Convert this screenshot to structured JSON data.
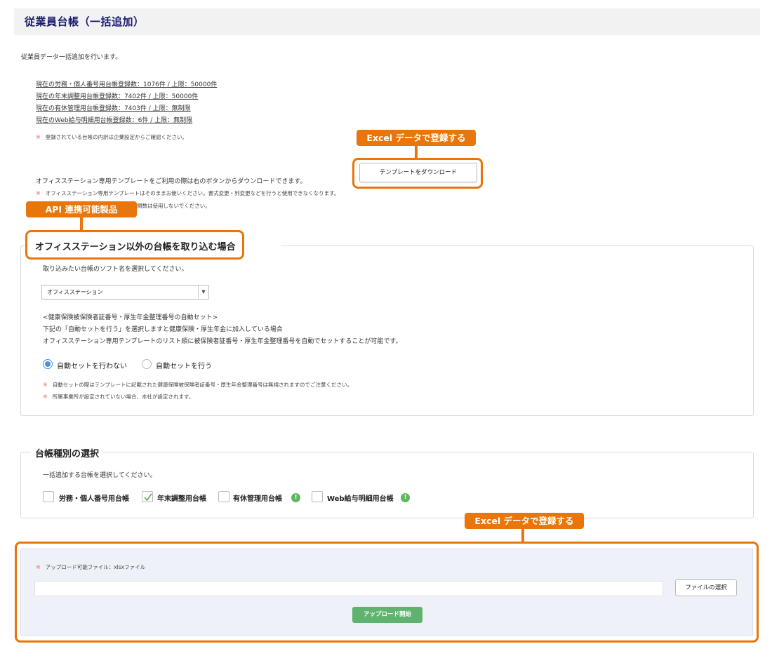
{
  "page": {
    "title": "従業員台帳（一括追加）",
    "intro": "従業員データ一括追加を行います。"
  },
  "counts": [
    "現在の労務・個人番号用台帳登録数：1076件 / 上限：50000件",
    "現在の年末調整用台帳登録数：7402件 / 上限：50000件",
    "現在の有休管理用台帳登録数：7403件 / 上限：無制限",
    "現在のWeb給与明細用台帳登録数：6件 / 上限：無制限"
  ],
  "notes": {
    "mark": "※",
    "ledger_detail": "登録されている台帳の内訳は企業設定からご確認ください。",
    "template_intro": "オフィスステーション専用テンプレートをご利用の際は右のボタンからダウンロードできます。",
    "template_note1": "オフィスステーション専用テンプレートはそのままお使いください。書式変更・列変更などを行うと使用できなくなります。",
    "template_note2_tail": "関数は使用しないでください。"
  },
  "callouts": {
    "excel_top": "Excel データで登録する",
    "api": "API 連携可能製品",
    "excel_bottom": "Excel データで登録する"
  },
  "buttons": {
    "template_download": "テンプレートをダウンロード",
    "file_select": "ファイルの選択",
    "upload_start": "アップロード開始"
  },
  "import_section": {
    "legend": "オフィスステーション以外の台帳を取り込む場合",
    "select_prompt": "取り込みたい台帳のソフト名を選択してください。",
    "select_value": "オフィスステーション",
    "auto_title": "<健康保険被保険者証番号・厚生年金整理番号の自動セット>",
    "auto_line1": "下記の「自動セットを行う」を選択しますと健康保険・厚生年金に加入している場合",
    "auto_line2": "オフィスステーション専用テンプレートのリスト順に被保険者証番号・厚生年金整理番号を自動でセットすることが可能です。",
    "radio_off": "自動セットを行わない",
    "radio_on": "自動セットを行う",
    "selected": "自動セットを行わない",
    "note1": "自動セットの際はテンプレートに記載された健康保険被保険者証番号・厚生年金整理番号は無視されますのでご注意ください。",
    "note2": "所属事業所が設定されていない場合、本社が設定されます。"
  },
  "ledger_section": {
    "legend": "台帳種別の選択",
    "prompt": "一括追加する台帳を選択してください。",
    "options": [
      {
        "label": "労務・個人番号用台帳",
        "checked": false
      },
      {
        "label": "年末調整用台帳",
        "checked": true
      },
      {
        "label": "有休管理用台帳",
        "checked": false
      },
      {
        "label": "Web給与明細用台帳",
        "checked": false
      }
    ],
    "info_icon": "!"
  },
  "upload": {
    "allowed": "アップロード可能ファイル：xlsxファイル",
    "file_value": ""
  },
  "colors": {
    "callout": "#e8760a",
    "title_text": "#1a1a6e",
    "radio_active": "#4a90d9",
    "upload_button": "#5fb36e",
    "info_icon": "#5cb85c",
    "note_mark": "#e36b6b"
  }
}
